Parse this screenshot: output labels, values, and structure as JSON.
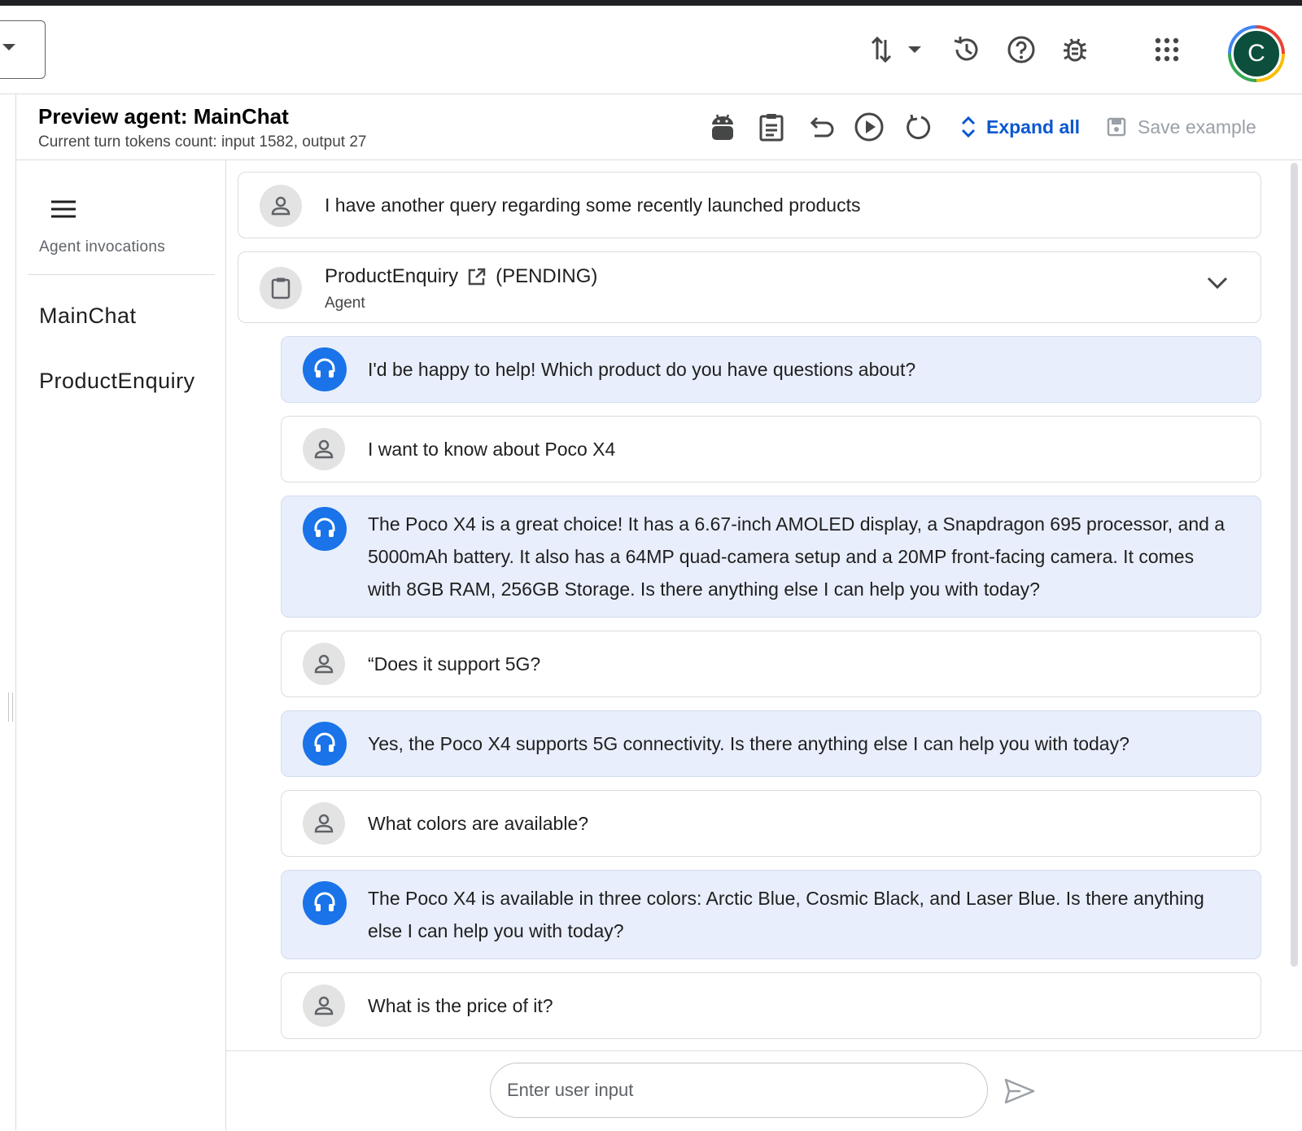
{
  "topbar": {
    "avatar_letter": "C"
  },
  "header": {
    "title": "Preview agent: MainChat",
    "subtitle": "Current turn tokens count: input 1582, output 27",
    "expand_all_label": "Expand all",
    "save_example_label": "Save example"
  },
  "sidebar": {
    "caption": "Agent invocations",
    "items": [
      {
        "label": "MainChat"
      },
      {
        "label": "ProductEnquiry"
      }
    ]
  },
  "conversation": {
    "first_user_message": "I have another query regarding some recently launched products",
    "agent_block": {
      "name": "ProductEnquiry",
      "status": "(PENDING)",
      "type_label": "Agent"
    },
    "messages": [
      {
        "role": "agent",
        "text": "I'd be happy to help! Which product do you have questions about?"
      },
      {
        "role": "user",
        "text": "I want to know about Poco X4"
      },
      {
        "role": "agent",
        "text": "The Poco X4 is a great choice! It has a 6.67-inch AMOLED display, a Snapdragon 695 processor, and a 5000mAh battery. It also has a 64MP quad-camera setup and a 20MP front-facing camera. It comes with 8GB RAM, 256GB Storage. Is there anything else I can help you with today?"
      },
      {
        "role": "user",
        "text": "“Does it support 5G?"
      },
      {
        "role": "agent",
        "text": "Yes, the Poco X4 supports 5G connectivity. Is there anything else I can help you with today?"
      },
      {
        "role": "user",
        "text": "What colors are available?"
      },
      {
        "role": "agent",
        "text": "The Poco X4 is available in three colors: Arctic Blue, Cosmic Black, and Laser Blue. Is there anything else I can help you with today?"
      },
      {
        "role": "user",
        "text": "What is the price of it?"
      }
    ]
  },
  "input": {
    "placeholder": "Enter user input",
    "value": ""
  },
  "colors": {
    "accent": "#0b57d0",
    "agent_avatar": "#1a73e8",
    "agent_bubble": "#e8eefb",
    "avatar_bg": "#0b4f3c"
  }
}
